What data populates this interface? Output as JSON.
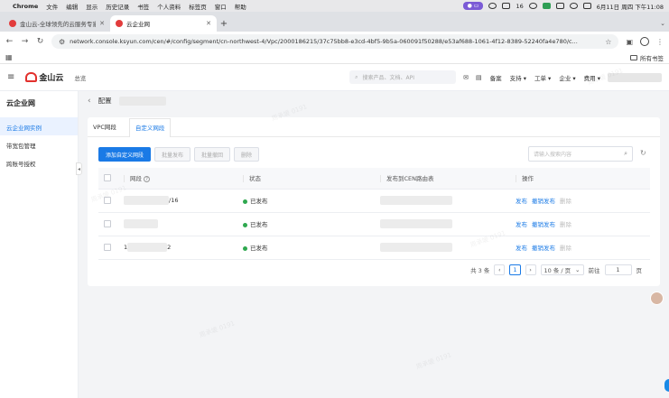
{
  "menubar": {
    "app": "Chrome",
    "items": [
      "文件",
      "编辑",
      "显示",
      "历史记录",
      "书签",
      "个人资料",
      "标签页",
      "窗口",
      "帮助"
    ],
    "battery_pct": "16",
    "datetime": "6月11日 周四 下午11:08"
  },
  "tabs": [
    {
      "title": "金山云-全球领先的云服务专家",
      "active": false
    },
    {
      "title": "云企业网",
      "active": true
    }
  ],
  "address": {
    "url": "network.console.ksyun.com/cen/#/config/segment/cn-northwest-4/Vpc/2000186215/37c75bb8-e3cd-4bf5-9b5a-060091f50288/e53af688-1061-4f12-8389-52240fa4e780/c..."
  },
  "bookmarks": {
    "all_label": "所有书签"
  },
  "header": {
    "brand": "金山云",
    "home": "总览",
    "search_placeholder": "搜索产品、文档、API",
    "links": [
      "备案",
      "支持 ▾",
      "工单 ▾",
      "企业 ▾",
      "费用 ▾"
    ]
  },
  "sidebar": {
    "title": "云企业网",
    "items": [
      {
        "label": "云企业网实例",
        "active": true
      },
      {
        "label": "带宽包管理",
        "active": false
      },
      {
        "label": "跨账号授权",
        "active": false
      }
    ]
  },
  "breadcrumb": {
    "label": "配置"
  },
  "panel": {
    "tabs": [
      {
        "label": "VPC网段",
        "active": false
      },
      {
        "label": "自定义网段",
        "active": true
      }
    ],
    "toolbar": {
      "add": "添加自定义网段",
      "batch_publish": "批量发布",
      "batch_withdraw": "批量撤回",
      "delete": "删除"
    },
    "search_placeholder": "请输入搜索内容",
    "columns": {
      "cidr": "网段",
      "status": "状态",
      "route_table": "发布到CEN路由表",
      "ops": "操作"
    },
    "rows": [
      {
        "cidr_suffix": "/16",
        "status": "已发布",
        "ops": [
          "发布",
          "撤销发布",
          "删除"
        ]
      },
      {
        "cidr_suffix": "",
        "status": "已发布",
        "ops": [
          "发布",
          "撤销发布",
          "删除"
        ]
      },
      {
        "cidr_prefix": "1",
        "cidr_suffix": "2",
        "status": "已发布",
        "ops": [
          "发布",
          "撤销发布",
          "删除"
        ]
      }
    ],
    "pager": {
      "total": "共 3 条",
      "current": "1",
      "page_size": "10 条 / 页",
      "goto_label": "前往",
      "goto_value": "1",
      "page_unit": "页"
    }
  },
  "watermark": "周承媛 0191",
  "colors": {
    "accent": "#1a7ae6",
    "published": "#2fa84f",
    "brand_red": "#e2312d"
  }
}
